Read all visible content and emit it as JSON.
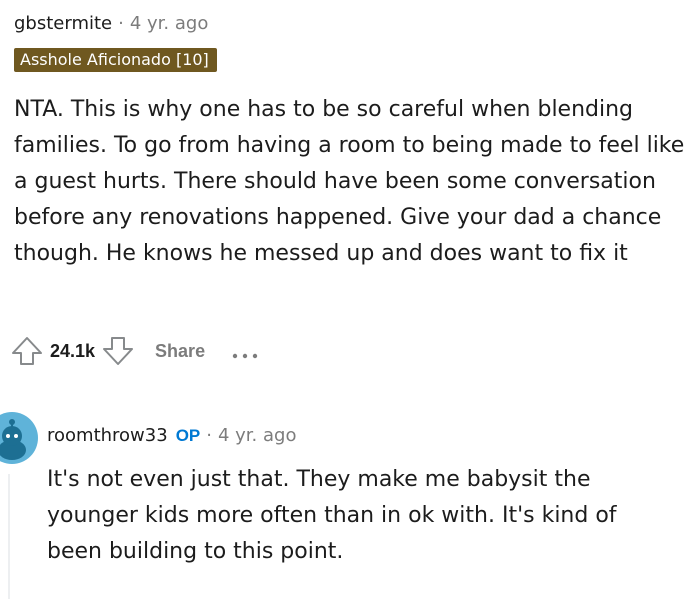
{
  "comment": {
    "username": "gbstermite",
    "separator": "·",
    "time": "4 yr. ago",
    "flair": "Asshole Aficionado [10]",
    "body": "NTA. This is why one has to be so careful when blending families. To go from having a room to being made to feel like a guest hurts. There should have been some conversation before any renovations happened. Give your dad a chance though. He knows he messed up and does want to fix it",
    "score": "24.1k",
    "share_label": "Share",
    "icons": {
      "upvote": "upvote-arrow-icon",
      "downvote": "downvote-arrow-icon",
      "more": "more-options-icon"
    }
  },
  "reply": {
    "username": "roomthrow33",
    "op_badge": "OP",
    "separator": "·",
    "time": "4 yr. ago",
    "body": "It's not even just that. They make me babysit the younger kids more often than in ok with. It's kind of been building to this point.",
    "avatar_color": "#5fb3d9"
  },
  "colors": {
    "flair_bg": "#6f5820",
    "op_blue": "#0079d3",
    "muted_text": "#7c7c7c"
  }
}
